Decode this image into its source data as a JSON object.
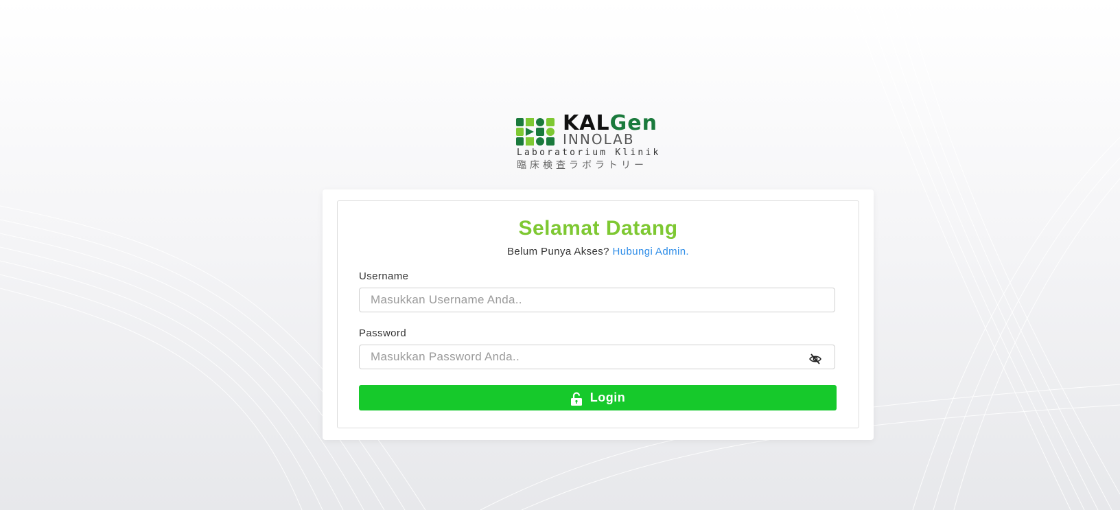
{
  "brand": {
    "title_part1": "KAL",
    "title_part2": "Gen",
    "subtitle": "INNOLAB",
    "tagline": "Laboratorium Klinik",
    "tagline_jp": "臨床検査ラボラトリー",
    "colors": {
      "dark_green": "#1a7a3c",
      "light_green": "#7ec832"
    }
  },
  "login": {
    "title": "Selamat Datang",
    "access_prompt": "Belum Punya Akses?",
    "contact_link": "Hubungi Admin.",
    "username_label": "Username",
    "username_placeholder": "Masukkan Username Anda..",
    "password_label": "Password",
    "password_placeholder": "Masukkan Password Anda..",
    "password_toggle_icon": "eye-slash-icon",
    "login_button": "Login",
    "login_icon": "unlock-icon",
    "colors": {
      "title": "#7ec832",
      "link": "#2e8de8",
      "button": "#16c92b"
    }
  }
}
